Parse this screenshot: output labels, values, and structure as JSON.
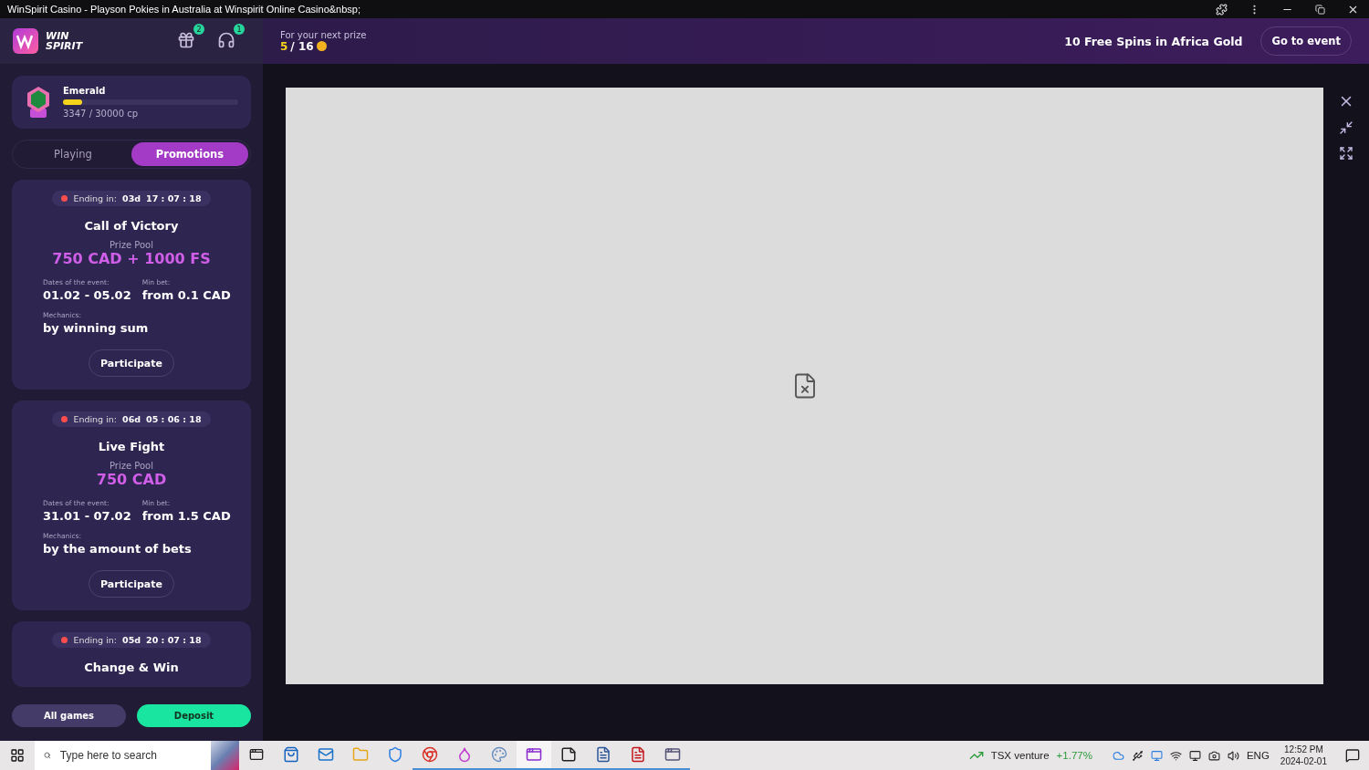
{
  "window": {
    "title": "WinSpirit Casino - Playson Pokies in Australia at Winspirit Online Casino&nbsp;"
  },
  "header": {
    "logo_top": "WIN",
    "logo_bottom": "SPIRIT",
    "gift_badge": "2",
    "support_badge": "1",
    "prize_label": "For your next prize",
    "prize_current": "5",
    "prize_total": "/ 16",
    "banner": "10 Free Spins in Africa Gold",
    "banner_button": "Go to event"
  },
  "status": {
    "tier": "Emerald",
    "level": 0.11,
    "points": "3347 / 30000 cp"
  },
  "tabs": [
    {
      "label": "Playing",
      "selected": false
    },
    {
      "label": "Promotions",
      "selected": true
    }
  ],
  "promotions": [
    {
      "ending_label": "Ending in:",
      "days": "03d",
      "time": "17 : 07 : 18",
      "title": "Call of Victory",
      "prize_label": "Prize Pool",
      "prize": "750 CAD + 1000 FS",
      "dates_label": "Dates of the event:",
      "dates": "01.02 - 05.02",
      "min_bet_label": "Min bet:",
      "min_bet": "from 0.1 CAD",
      "mechanics_label": "Mechanics:",
      "mechanics": "by winning sum",
      "button": "Participate"
    },
    {
      "ending_label": "Ending in:",
      "days": "06d",
      "time": "05 : 06 : 18",
      "title": "Live Fight",
      "prize_label": "Prize Pool",
      "prize": "750 CAD",
      "dates_label": "Dates of the event:",
      "dates": "31.01 - 07.02",
      "min_bet_label": "Min bet:",
      "min_bet": "from 1.5 CAD",
      "mechanics_label": "Mechanics:",
      "mechanics": "by the amount of bets",
      "button": "Participate"
    },
    {
      "ending_label": "Ending in:",
      "days": "05d",
      "time": "20 : 07 : 18",
      "title": "Change & Win"
    }
  ],
  "sidebar_buttons": {
    "all_games": "All games",
    "deposit": "Deposit"
  },
  "taskbar": {
    "search_placeholder": "Type here to search",
    "apps": [
      {
        "kind": "store",
        "running": false
      },
      {
        "kind": "mail",
        "running": false
      },
      {
        "kind": "folder",
        "running": false
      },
      {
        "kind": "shield",
        "running": false
      },
      {
        "kind": "chrome",
        "running": true
      },
      {
        "kind": "drop",
        "running": true
      },
      {
        "kind": "palette",
        "running": true
      },
      {
        "kind": "casino",
        "running": true
      },
      {
        "kind": "notes",
        "running": true
      },
      {
        "kind": "word",
        "running": true
      },
      {
        "kind": "pdf",
        "running": true
      },
      {
        "kind": "window",
        "running": true
      }
    ],
    "stock_name": "TSX venture",
    "stock_change": "+1.77%",
    "language": "ENG",
    "time": "12:52 PM",
    "date": "2024-02-01"
  }
}
